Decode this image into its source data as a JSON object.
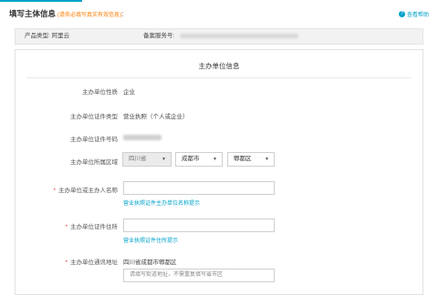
{
  "header": {
    "title": "填写主体信息",
    "note": "(请务必填写真实有效信息)",
    "colon": ":",
    "help_label": "查看帮助",
    "help_icon": "question-icon"
  },
  "info_bar": {
    "product_type_label": "产品类型: 阿里云",
    "service_no_label": "备案服务号:"
  },
  "form": {
    "section_title": "主办单位信息",
    "nature": {
      "label": "主办单位性质",
      "value": "企业"
    },
    "cert_type": {
      "label": "主办单位证件类型",
      "value": "营业执照（个人或企业）"
    },
    "cert_no": {
      "label": "主办单位证件号码"
    },
    "region": {
      "label": "主办单位所属区域",
      "province": "四川省",
      "city": "成都市",
      "district": "郫都区",
      "caret": "▼"
    },
    "name": {
      "required_mark": "*",
      "label": "主办单位或主办人名称",
      "value": "",
      "hint": "营业执照证件主办单位名称提示"
    },
    "address": {
      "required_mark": "*",
      "label": "主办单位证件住所",
      "value": "",
      "hint": "营业执照证件住所提示"
    },
    "mail_address": {
      "required_mark": "*",
      "label": "主办单位通讯地址",
      "prefix": "四川省成都市郫都区",
      "placeholder": "请填写街道地址，不需重复填写省市区"
    }
  }
}
